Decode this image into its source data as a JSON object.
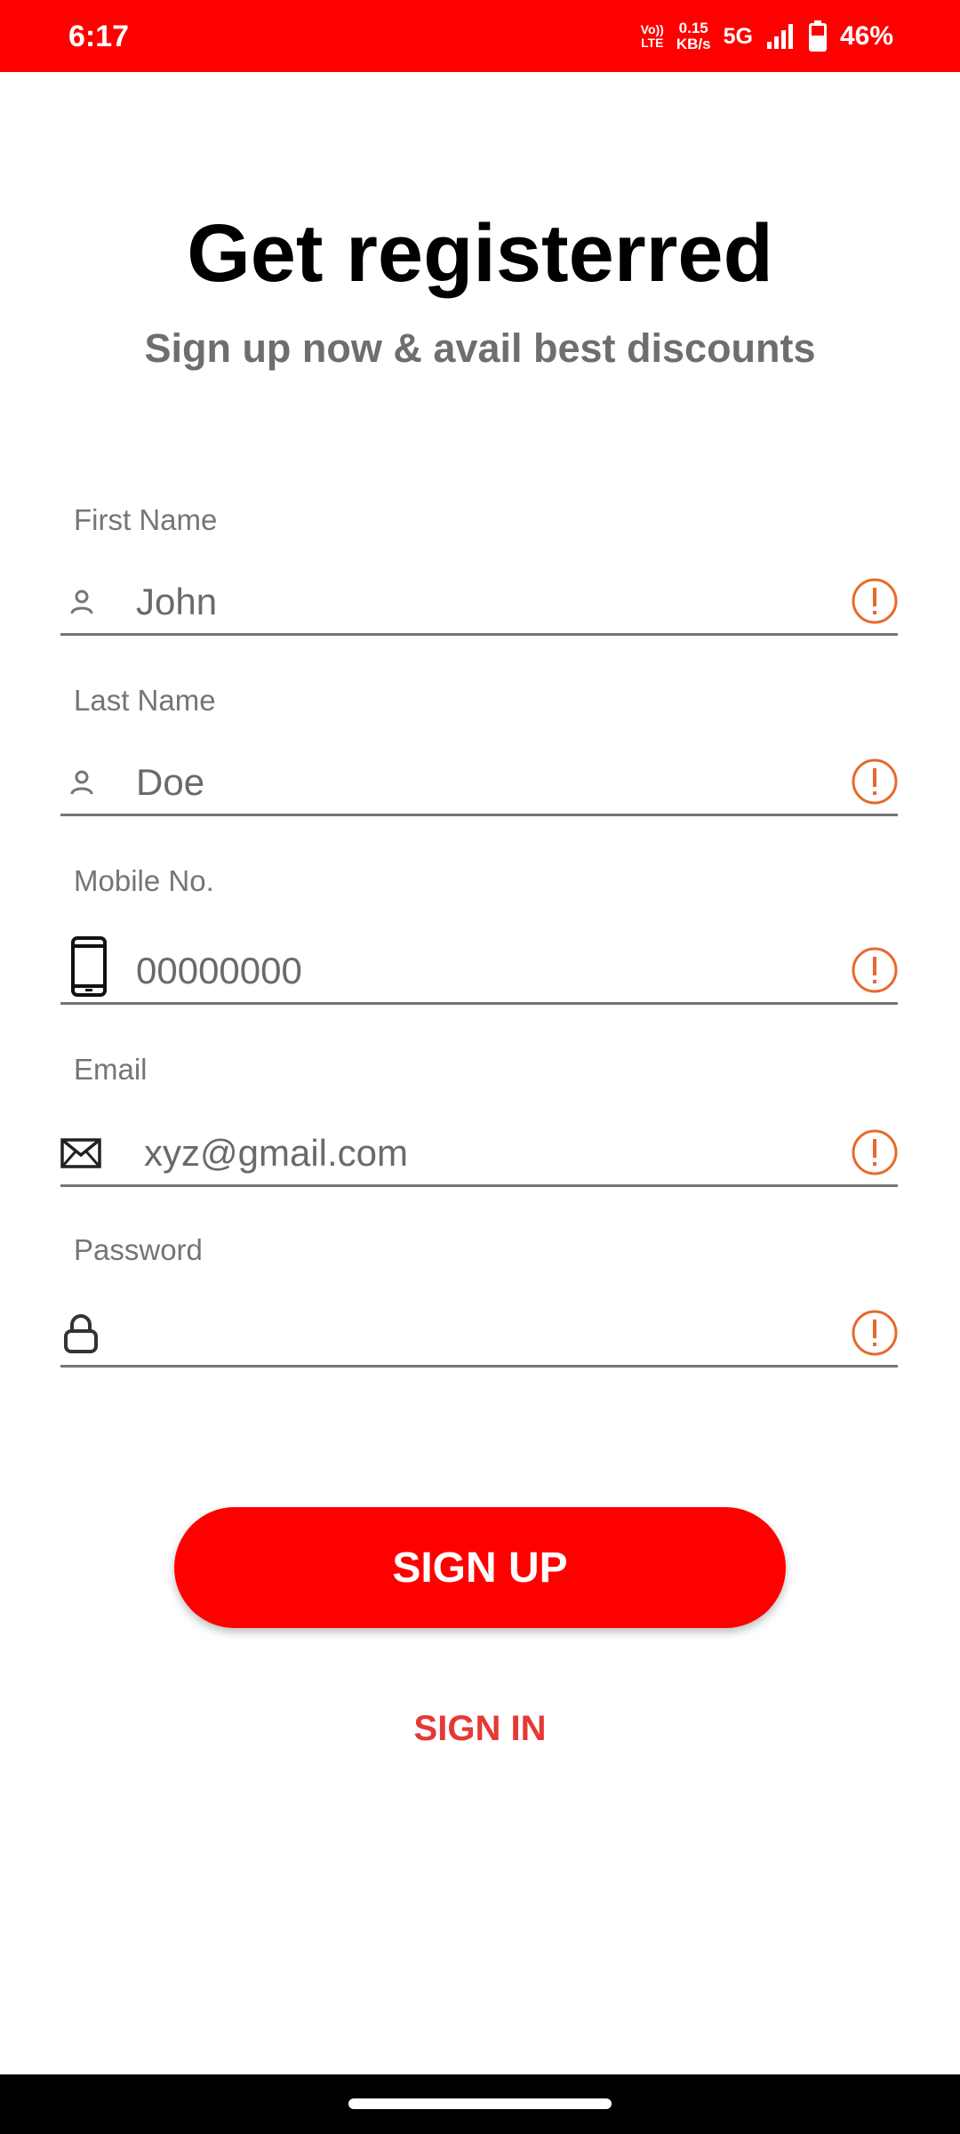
{
  "status_bar": {
    "time": "6:17",
    "volte_top": "Vo))",
    "volte_bottom": "LTE",
    "speed_value": "0.15",
    "speed_unit": "KB/s",
    "network": "5G",
    "battery_percent": "46%"
  },
  "header": {
    "title": "Get registerred",
    "subtitle": "Sign up now & avail best discounts"
  },
  "form": {
    "first_name": {
      "label": "First Name",
      "value": "John"
    },
    "last_name": {
      "label": "Last Name",
      "value": "Doe"
    },
    "mobile": {
      "label": "Mobile No.",
      "placeholder": "00000000"
    },
    "email": {
      "label": "Email",
      "placeholder": "xyz@gmail.com"
    },
    "password": {
      "label": "Password",
      "value": ""
    }
  },
  "actions": {
    "sign_up_label": "SIGN UP",
    "sign_in_label": "SIGN IN"
  },
  "colors": {
    "brand_red": "#ff0000",
    "error_orange": "#e8692a",
    "link_red": "#e53935"
  }
}
